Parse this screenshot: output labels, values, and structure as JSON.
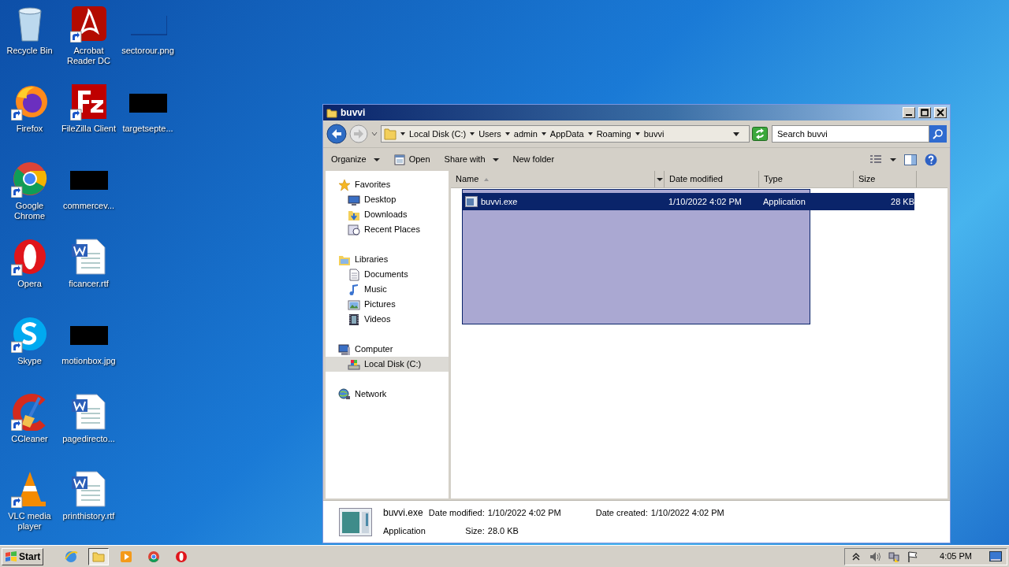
{
  "desktop": {
    "icons": [
      {
        "label": "Recycle Bin",
        "kind": "recycle-bin",
        "shortcut": false
      },
      {
        "label": "Firefox",
        "kind": "firefox",
        "shortcut": true
      },
      {
        "label": "Google Chrome",
        "kind": "chrome",
        "shortcut": true
      },
      {
        "label": "Opera",
        "kind": "opera",
        "shortcut": true
      },
      {
        "label": "Skype",
        "kind": "skype",
        "shortcut": true
      },
      {
        "label": "CCleaner",
        "kind": "ccleaner",
        "shortcut": true
      },
      {
        "label": "VLC media player",
        "kind": "vlc",
        "shortcut": true
      },
      {
        "label": "Acrobat Reader DC",
        "kind": "acrobat",
        "shortcut": true
      },
      {
        "label": "FileZilla Client",
        "kind": "filezilla",
        "shortcut": true
      },
      {
        "label": "commercev...",
        "kind": "thumbnail",
        "shortcut": false
      },
      {
        "label": "ficancer.rtf",
        "kind": "document",
        "shortcut": false
      },
      {
        "label": "motionbox.jpg",
        "kind": "thumbnail",
        "shortcut": false
      },
      {
        "label": "pagedirecto...",
        "kind": "document",
        "shortcut": false
      },
      {
        "label": "printhistory.rtf",
        "kind": "document",
        "shortcut": false
      },
      {
        "label": "sectorour.png",
        "kind": "blank-thumbnail",
        "shortcut": false
      },
      {
        "label": "targetsepte...",
        "kind": "thumbnail",
        "shortcut": false
      }
    ]
  },
  "window": {
    "title": "buvvi",
    "breadcrumbs": [
      "Local Disk (C:)",
      "Users",
      "admin",
      "AppData",
      "Roaming",
      "buvvi"
    ],
    "search": {
      "placeholder": "Search buvvi"
    },
    "toolbar": [
      {
        "label": "Organize",
        "has_menu": true,
        "kind": "text"
      },
      {
        "label": "Open",
        "has_menu": false,
        "kind": "open"
      },
      {
        "label": "Share with",
        "has_menu": true,
        "kind": "text"
      },
      {
        "label": "New folder",
        "has_menu": false,
        "kind": "text"
      }
    ],
    "navigation": [
      {
        "label": "Favorites",
        "kind": "star",
        "selected": false,
        "children": [
          {
            "label": "Desktop",
            "kind": "desktop",
            "selected": false
          },
          {
            "label": "Downloads",
            "kind": "downloads",
            "selected": false
          },
          {
            "label": "Recent Places",
            "kind": "recent",
            "selected": false
          }
        ]
      },
      {
        "label": "Libraries",
        "kind": "library",
        "selected": false,
        "children": [
          {
            "label": "Documents",
            "kind": "documents",
            "selected": false
          },
          {
            "label": "Music",
            "kind": "music",
            "selected": false
          },
          {
            "label": "Pictures",
            "kind": "pictures",
            "selected": false
          },
          {
            "label": "Videos",
            "kind": "videos",
            "selected": false
          }
        ]
      },
      {
        "label": "Computer",
        "kind": "computer",
        "selected": false,
        "children": [
          {
            "label": "Local Disk (C:)",
            "kind": "disk",
            "selected": true
          }
        ]
      },
      {
        "label": "Network",
        "kind": "network",
        "selected": false
      }
    ],
    "table": {
      "columns": [
        {
          "label": "Name",
          "sorted": true
        },
        {
          "label": "Date modified",
          "sorted": false
        },
        {
          "label": "Type",
          "sorted": false
        },
        {
          "label": "Size",
          "sorted": false
        }
      ],
      "rows": [
        {
          "name": "buvvi.exe",
          "date_modified": "1/10/2022 4:02 PM",
          "type": "Application",
          "size": "28 KB",
          "selected": true
        }
      ]
    },
    "details": {
      "name": "buvvi.exe",
      "type": "Application",
      "fields": [
        {
          "label": "Date modified:",
          "value": "1/10/2022 4:02 PM"
        },
        {
          "label": "Size:",
          "value": "28.0 KB"
        },
        {
          "label": "Date created:",
          "value": "1/10/2022 4:02 PM"
        }
      ]
    }
  },
  "taskbar": {
    "start": "Start",
    "apps": [
      {
        "kind": "ie",
        "selected": false
      },
      {
        "kind": "explorer",
        "selected": true
      },
      {
        "kind": "media",
        "selected": false
      },
      {
        "kind": "chrome",
        "selected": false
      },
      {
        "kind": "opera",
        "selected": false
      }
    ],
    "clock": "4:05 PM"
  }
}
